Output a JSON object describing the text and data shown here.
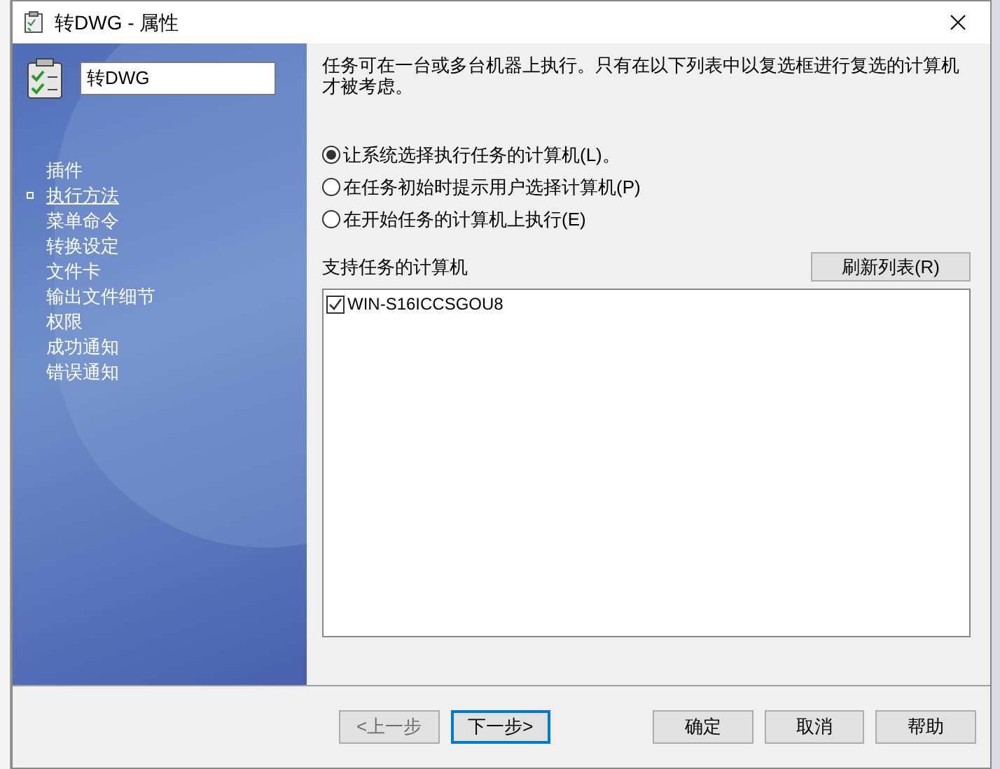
{
  "window": {
    "title": "转DWG - 属性"
  },
  "task_name": {
    "value": "转DWG"
  },
  "nav": [
    {
      "label": "插件",
      "selected": false
    },
    {
      "label": "执行方法",
      "selected": true
    },
    {
      "label": "菜单命令",
      "selected": false
    },
    {
      "label": "转换设定",
      "selected": false
    },
    {
      "label": "文件卡",
      "selected": false
    },
    {
      "label": "输出文件细节",
      "selected": false
    },
    {
      "label": "权限",
      "selected": false
    },
    {
      "label": "成功通知",
      "selected": false
    },
    {
      "label": "错误通知",
      "selected": false
    }
  ],
  "description": "任务可在一台或多台机器上执行。只有在以下列表中以复选框进行复选的计算机才被考虑。",
  "options": [
    {
      "label": "让系统选择执行任务的计算机(L)。",
      "selected": true
    },
    {
      "label": "在任务初始时提示用户选择计算机(P)",
      "selected": false
    },
    {
      "label": "在开始任务的计算机上执行(E)",
      "selected": false
    }
  ],
  "computers_label": "支持任务的计算机",
  "refresh_button": "刷新列表(R)",
  "computers": [
    {
      "name": "WIN-S16ICCSGOU8",
      "checked": true
    }
  ],
  "buttons": [
    {
      "label": "<上一步",
      "disabled": true,
      "focused": false
    },
    {
      "label": "下一步>",
      "disabled": false,
      "focused": true
    },
    {
      "label": "确定",
      "disabled": false,
      "focused": false
    },
    {
      "label": "取消",
      "disabled": false,
      "focused": false
    },
    {
      "label": "帮助",
      "disabled": false,
      "focused": false
    }
  ]
}
